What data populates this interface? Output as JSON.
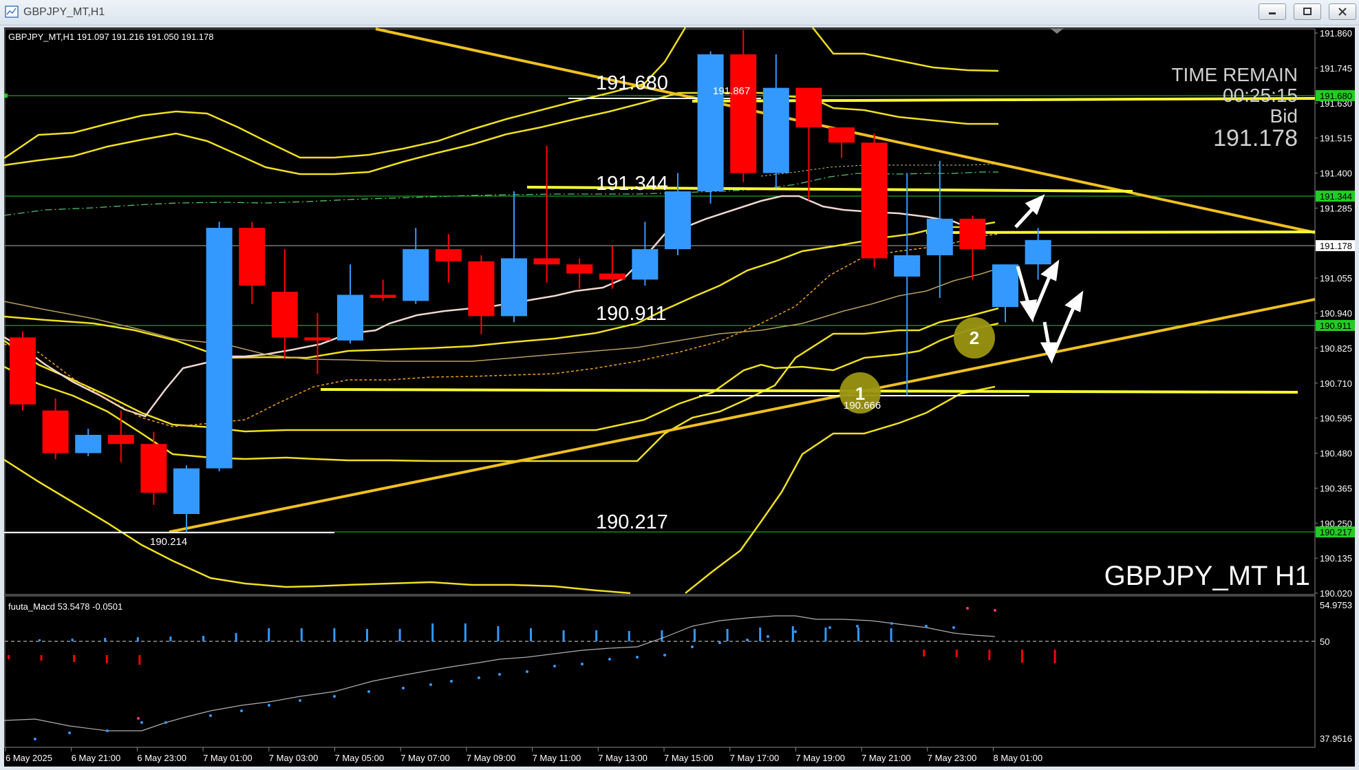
{
  "window": {
    "title": "GBPJPY_MT,H1"
  },
  "main_chart": {
    "header": "GBPJPY_MT,H1  191.097 191.216 191.050 191.178",
    "symbol_label": "GBPJPY_MT H1",
    "time_remain_label": "TIME REMAIN",
    "time_remain_value": "00:25:15",
    "bid_label": "Bid",
    "bid_value": "191.178",
    "level_labels": {
      "l191680": "191.680",
      "l191344": "191.344",
      "l190911": "190.911",
      "l190217": "190.217",
      "high": "191.867",
      "low1": "190.214",
      "low2": "190.666"
    },
    "price_axis": [
      "191.860",
      "191.745",
      "191.630",
      "191.515",
      "191.400",
      "191.285",
      "191.055",
      "190.940",
      "190.825",
      "190.710",
      "190.595",
      "190.480",
      "190.365",
      "190.250",
      "190.135",
      "190.020"
    ],
    "axis_badges": {
      "b191680": "191.680",
      "b191344": "191.344",
      "b191178": "191.178",
      "b190911": "190.911",
      "b190217": "190.217"
    },
    "markers": {
      "m1": "1",
      "m2": "2"
    }
  },
  "macd": {
    "header": "fuuta_Macd 53.5478  -0.0501",
    "axis": {
      "top": "54.9753",
      "mid": "50",
      "bottom": "37.9516"
    }
  },
  "time_axis": [
    "6 May 2025",
    "6 May 21:00",
    "6 May 23:00",
    "7 May 01:00",
    "7 May 03:00",
    "7 May 05:00",
    "7 May 07:00",
    "7 May 09:00",
    "7 May 11:00",
    "7 May 13:00",
    "7 May 15:00",
    "7 May 17:00",
    "7 May 19:00",
    "7 May 21:00",
    "7 May 23:00",
    "8 May 01:00"
  ],
  "colors": {
    "bull": "#3399ff",
    "bear": "#ff0000",
    "trend": "#ffff33",
    "grid_level": "#22cc22",
    "background": "#000000"
  },
  "chart_data": {
    "type": "candlestick",
    "timeframe": "H1",
    "candles": [
      {
        "o": 190.86,
        "h": 190.88,
        "l": 190.62,
        "c": 190.64
      },
      {
        "o": 190.62,
        "h": 190.66,
        "l": 190.46,
        "c": 190.48
      },
      {
        "o": 190.48,
        "h": 190.56,
        "l": 190.47,
        "c": 190.54
      },
      {
        "o": 190.54,
        "h": 190.62,
        "l": 190.45,
        "c": 190.51
      },
      {
        "o": 190.51,
        "h": 190.55,
        "l": 190.31,
        "c": 190.35
      },
      {
        "o": 190.28,
        "h": 190.44,
        "l": 190.22,
        "c": 190.43
      },
      {
        "o": 190.43,
        "h": 191.24,
        "l": 190.42,
        "c": 191.22
      },
      {
        "o": 191.22,
        "h": 191.24,
        "l": 190.97,
        "c": 191.03
      },
      {
        "o": 191.01,
        "h": 191.15,
        "l": 190.79,
        "c": 190.86
      },
      {
        "o": 190.86,
        "h": 190.94,
        "l": 190.74,
        "c": 190.85
      },
      {
        "o": 190.85,
        "h": 191.1,
        "l": 190.84,
        "c": 191.0
      },
      {
        "o": 191.0,
        "h": 191.05,
        "l": 190.98,
        "c": 190.99
      },
      {
        "o": 190.98,
        "h": 191.22,
        "l": 190.97,
        "c": 191.15
      },
      {
        "o": 191.15,
        "h": 191.2,
        "l": 191.04,
        "c": 191.11
      },
      {
        "o": 191.11,
        "h": 191.13,
        "l": 190.87,
        "c": 190.93
      },
      {
        "o": 190.93,
        "h": 191.34,
        "l": 190.91,
        "c": 191.12
      },
      {
        "o": 191.12,
        "h": 191.49,
        "l": 191.04,
        "c": 191.1
      },
      {
        "o": 191.1,
        "h": 191.12,
        "l": 191.02,
        "c": 191.07
      },
      {
        "o": 191.07,
        "h": 191.16,
        "l": 191.02,
        "c": 191.05
      },
      {
        "o": 191.05,
        "h": 191.24,
        "l": 191.03,
        "c": 191.15
      },
      {
        "o": 191.15,
        "h": 191.4,
        "l": 191.13,
        "c": 191.34
      },
      {
        "o": 191.34,
        "h": 191.8,
        "l": 191.3,
        "c": 191.79
      },
      {
        "o": 191.79,
        "h": 191.87,
        "l": 191.37,
        "c": 191.4
      },
      {
        "o": 191.4,
        "h": 191.79,
        "l": 191.35,
        "c": 191.68
      },
      {
        "o": 191.68,
        "h": 191.68,
        "l": 191.31,
        "c": 191.55
      },
      {
        "o": 191.55,
        "h": 191.52,
        "l": 191.45,
        "c": 191.5
      },
      {
        "o": 191.5,
        "h": 191.53,
        "l": 191.09,
        "c": 191.12
      },
      {
        "o": 191.06,
        "h": 191.4,
        "l": 190.67,
        "c": 191.13
      },
      {
        "o": 191.13,
        "h": 191.44,
        "l": 190.99,
        "c": 191.25
      },
      {
        "o": 191.25,
        "h": 191.26,
        "l": 191.05,
        "c": 191.15
      },
      {
        "o": 190.96,
        "h": 191.1,
        "l": 190.91,
        "c": 191.1
      },
      {
        "o": 191.1,
        "h": 191.22,
        "l": 191.05,
        "c": 191.18
      }
    ],
    "horizontal_levels": [
      191.68,
      191.344,
      191.178,
      190.911,
      190.217
    ],
    "y_range": [
      190.02,
      191.86
    ]
  }
}
